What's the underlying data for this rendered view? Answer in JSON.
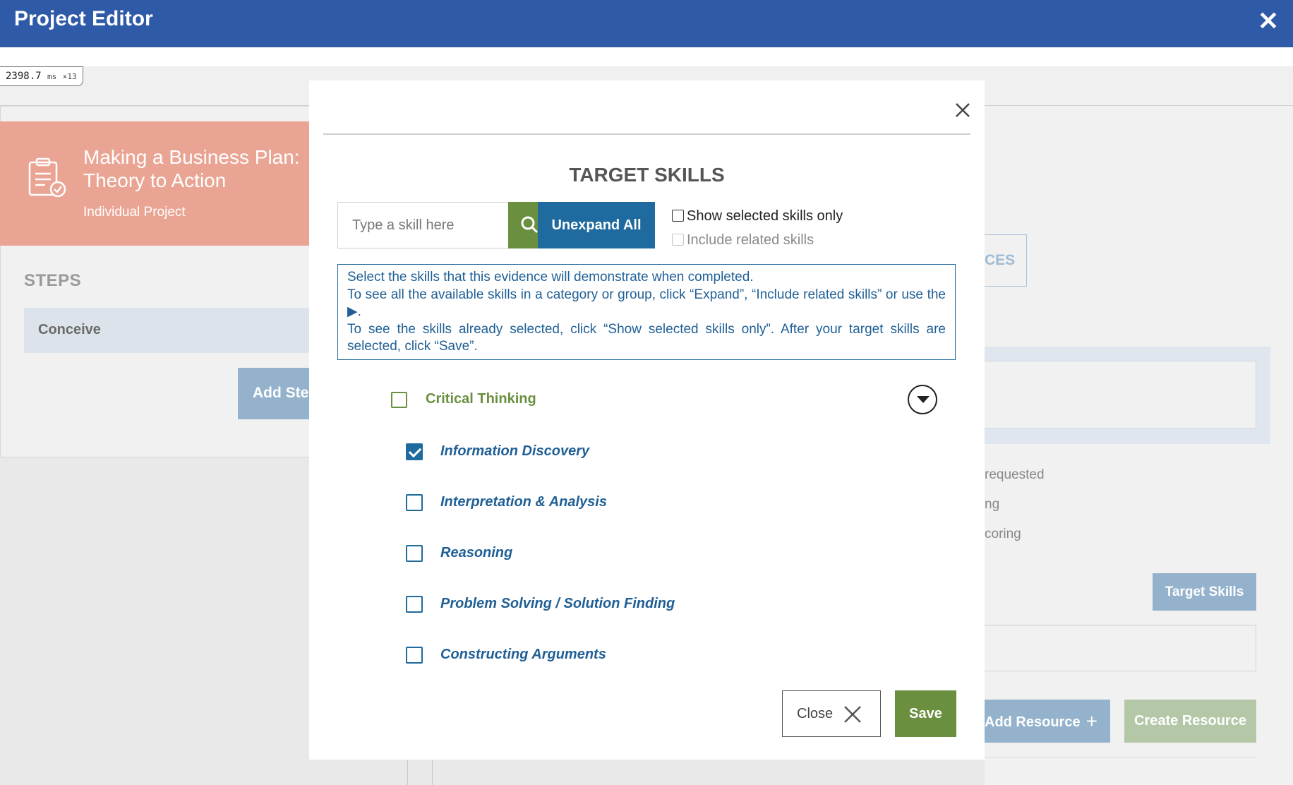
{
  "app": {
    "title": "Project Editor",
    "close_glyph": "✕"
  },
  "timer": {
    "value": "2398.7",
    "unit": "ms",
    "count": "×13"
  },
  "project": {
    "title": "Making a Business Plan: Theory to Action",
    "type": "Individual Project",
    "icon": "clipboard-check-icon"
  },
  "steps": {
    "heading": "STEPS",
    "items": [
      "Conceive"
    ],
    "add_label": "Add Step"
  },
  "background": {
    "resources_tab_fragment": "CES",
    "option_fragments": [
      "requested",
      "ng",
      "coring"
    ],
    "target_skills_label": "Target Skills",
    "add_resource_label": "Add Resource",
    "create_resource_label": "Create Resource"
  },
  "modal": {
    "title": "TARGET SKILLS",
    "search": {
      "placeholder": "Type a skill here",
      "value": ""
    },
    "unexpand_label": "Unexpand All",
    "show_selected_label": "Show selected skills only",
    "include_related_label": "Include related skills",
    "info": {
      "line1": "Select the skills that this evidence will demonstrate when completed.",
      "line2a": "To see all the available skills in a category or group, click “Expand”, “Include related skills” or use the",
      "line2b": ".",
      "line3": "To see the skills already selected, click “Show selected skills only”. After your target skills are selected, click “Save”."
    },
    "category": {
      "label": "Critical Thinking",
      "checked": false
    },
    "skills": [
      {
        "label": "Information Discovery",
        "checked": true
      },
      {
        "label": "Interpretation & Analysis",
        "checked": false
      },
      {
        "label": "Reasoning",
        "checked": false
      },
      {
        "label": "Problem Solving / Solution Finding",
        "checked": false
      },
      {
        "label": "Constructing Arguments",
        "checked": false
      }
    ],
    "close_label": "Close",
    "save_label": "Save"
  },
  "colors": {
    "header_blue": "#2f5aa8",
    "project_salmon": "#eaa493",
    "skill_blue": "#1f6a9e",
    "category_green": "#6a8f3f"
  }
}
